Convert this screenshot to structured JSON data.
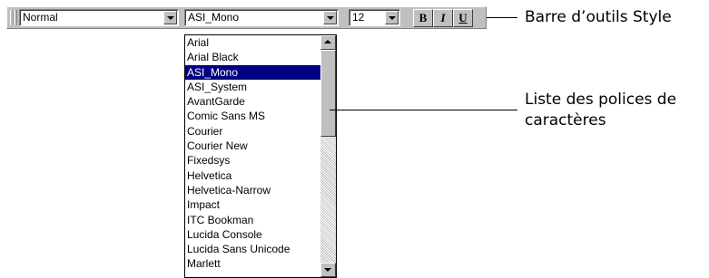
{
  "toolbar": {
    "style_value": "Normal",
    "font_value": "ASI_Mono",
    "size_value": "12",
    "bold_label": "B",
    "italic_label": "I",
    "underline_label": "U"
  },
  "font_list": {
    "items": [
      "Arial",
      "Arial Black",
      "ASI_Mono",
      "ASI_System",
      "AvantGarde",
      "Comic Sans MS",
      "Courier",
      "Courier New",
      "Fixedsys",
      "Helvetica",
      "Helvetica-Narrow",
      "Impact",
      "ITC Bookman",
      "Lucida Console",
      "Lucida Sans Unicode",
      "Marlett"
    ],
    "selected": "ASI_Mono"
  },
  "callouts": {
    "toolbar_label": "Barre d’outils Style",
    "list_label_line1": "Liste des polices de",
    "list_label_line2": "caractères"
  },
  "colors": {
    "toolbar_bg": "#c0c0c0",
    "selection_bg": "#000080"
  }
}
